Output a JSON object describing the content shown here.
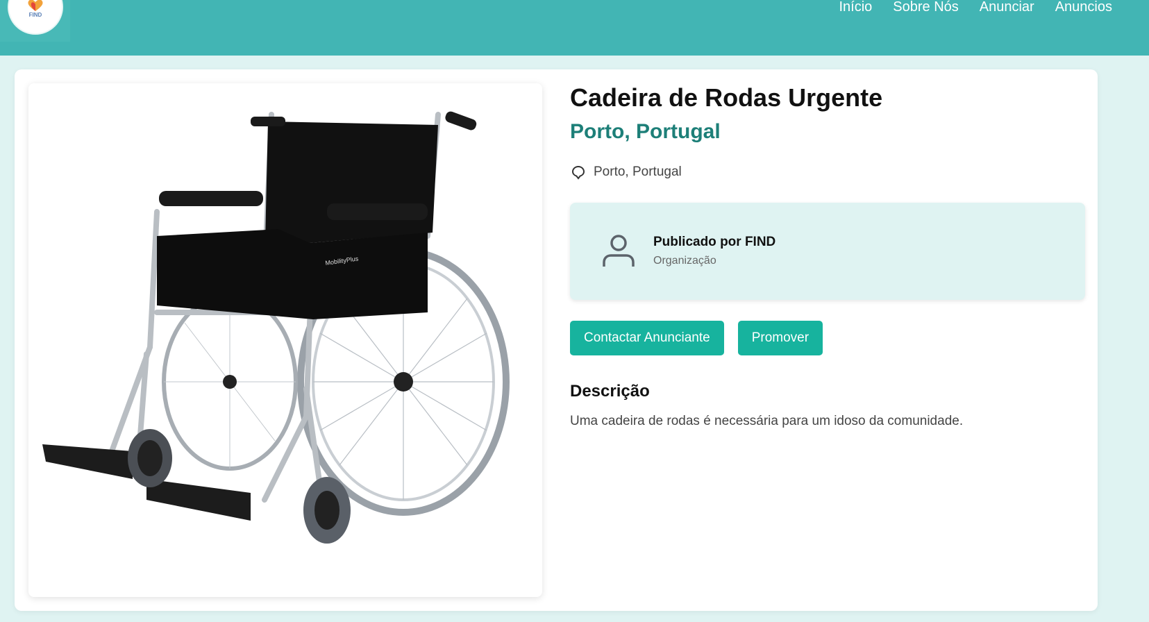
{
  "header": {
    "logo_text": "FIND",
    "nav": [
      "Início",
      "Sobre Nós",
      "Anunciar",
      "Anuncios"
    ]
  },
  "listing": {
    "title": "Cadeira de Rodas Urgente",
    "city": "Porto, Portugal",
    "location": "Porto, Portugal",
    "image_alt": "wheelchair-photo",
    "chair_brand": "MobilityPlus",
    "publisher": {
      "name": "Publicado por FIND",
      "role": "Organização"
    },
    "buttons": {
      "contact": "Contactar Anunciante",
      "promote": "Promover"
    },
    "description_title": "Descrição",
    "description": "Uma cadeira de rodas é necessária para um idoso da comunidade."
  },
  "colors": {
    "header": "#42b5b4",
    "background": "#dff3f2",
    "accent_text": "#1d7f78",
    "button": "#17b39e"
  },
  "icons": {
    "location": "location-pin-icon",
    "publisher": "user-icon"
  }
}
